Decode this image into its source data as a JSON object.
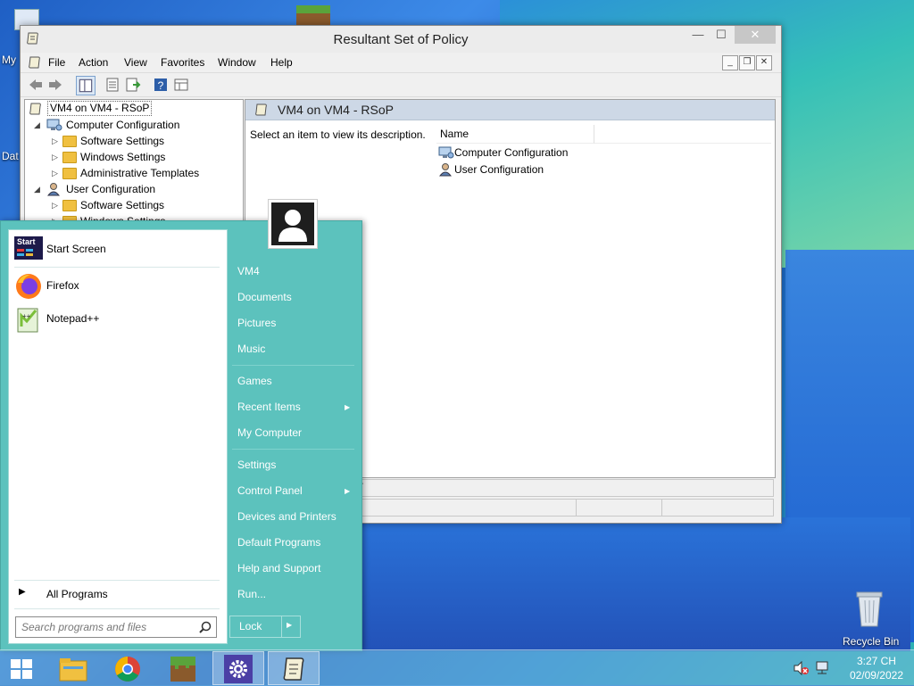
{
  "desktop": {
    "left_labels": [
      "My",
      "Dat"
    ],
    "recycle_bin_label": "Recycle Bin"
  },
  "window": {
    "title": "Resultant Set of Policy",
    "controls": {
      "minimize": "—",
      "maximize": "☐",
      "close": "✕"
    },
    "menu": [
      "File",
      "Action",
      "View",
      "Favorites",
      "Window",
      "Help"
    ],
    "mdi_controls": {
      "minimize": "_",
      "restore": "❐",
      "close": "✕"
    },
    "tree": [
      {
        "label": "VM4 on VM4 - RSoP",
        "indent": 0,
        "icon": "rsop-icon"
      },
      {
        "label": "Computer Configuration",
        "indent": 1,
        "icon": "computer-config-icon",
        "expanded": true
      },
      {
        "label": "Software Settings",
        "indent": 2,
        "icon": "folder-icon"
      },
      {
        "label": "Windows Settings",
        "indent": 2,
        "icon": "folder-icon"
      },
      {
        "label": "Administrative Templates",
        "indent": 2,
        "icon": "folder-icon"
      },
      {
        "label": "User Configuration",
        "indent": 1,
        "icon": "user-config-icon",
        "expanded": true
      },
      {
        "label": "Software Settings",
        "indent": 2,
        "icon": "folder-icon"
      },
      {
        "label": "Windows Settings",
        "indent": 2,
        "icon": "folder-icon"
      }
    ],
    "right_pane": {
      "header": "VM4 on VM4 - RSoP",
      "description": "Select an item to view its description.",
      "column_name": "Name",
      "items": [
        "Computer Configuration",
        "User Configuration"
      ],
      "tabs_partial": "7"
    }
  },
  "start_menu": {
    "pinned": [
      {
        "label": "Start Screen",
        "icon": "start-screen-icon",
        "icon_text": "Start"
      },
      {
        "label": "Firefox",
        "icon": "firefox-icon"
      },
      {
        "label": "Notepad++",
        "icon": "notepad-plus-plus-icon"
      }
    ],
    "all_programs": "All Programs",
    "search_placeholder": "Search programs and files",
    "right_items": [
      {
        "label": "VM4"
      },
      {
        "label": "Documents"
      },
      {
        "label": "Pictures"
      },
      {
        "label": "Music"
      },
      {
        "label": "Games"
      },
      {
        "label": "Recent Items",
        "submenu": true
      },
      {
        "label": "My Computer"
      },
      {
        "label": "Settings"
      },
      {
        "label": "Control Panel",
        "submenu": true
      },
      {
        "label": "Devices and Printers"
      },
      {
        "label": "Default Programs"
      },
      {
        "label": "Help and Support"
      },
      {
        "label": "Run..."
      }
    ],
    "lock_label": "Lock"
  },
  "taskbar": {
    "clock_time": "3:27 CH",
    "clock_date": "02/09/2022"
  },
  "colors": {
    "start_menu_bg": "#5cc2bd",
    "window_header": "#cdd8e6",
    "folder": "#f0c040"
  }
}
